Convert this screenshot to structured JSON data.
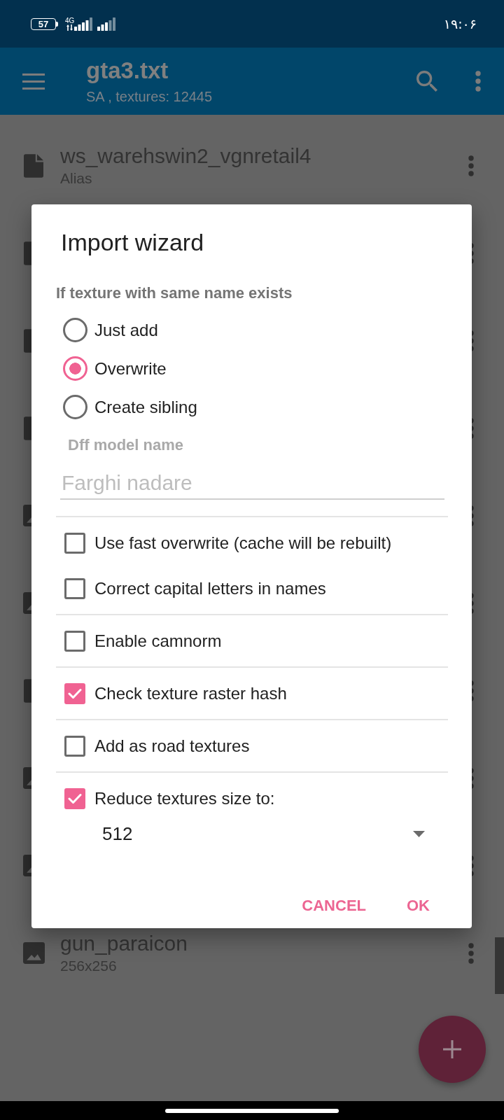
{
  "status_bar": {
    "battery": "57",
    "network": "4G",
    "time": "۱۹:۰۶"
  },
  "toolbar": {
    "title": "gta3.txt",
    "subtitle": "SA , textures: 12445"
  },
  "files": [
    {
      "kind": "file",
      "name": "ws_warehswin2_vgnretail4",
      "detail": "Alias"
    },
    {
      "kind": "file"
    },
    {
      "kind": "file"
    },
    {
      "kind": "file"
    },
    {
      "kind": "image"
    },
    {
      "kind": "image"
    },
    {
      "kind": "file"
    },
    {
      "kind": "image"
    },
    {
      "kind": "image"
    },
    {
      "kind": "image",
      "name": "gun_paraicon",
      "detail": "256x256"
    }
  ],
  "dialog": {
    "title": "Import wizard",
    "section_label": "If texture with same name exists",
    "options": [
      {
        "label": "Just add",
        "selected": false
      },
      {
        "label": "Overwrite",
        "selected": true
      },
      {
        "label": "Create sibling",
        "selected": false
      }
    ],
    "model_field": {
      "label": "Dff model name",
      "placeholder": "Farghi nadare",
      "disabled": true
    },
    "checkbox_groups": [
      {
        "items": [
          {
            "label": "Use fast overwrite (cache will be rebuilt)",
            "checked": false
          },
          {
            "label": "Correct capital letters in names",
            "checked": false
          }
        ]
      },
      {
        "items": [
          {
            "label": "Enable camnorm",
            "checked": false
          }
        ]
      },
      {
        "items": [
          {
            "label": "Check texture raster hash",
            "checked": true
          }
        ]
      },
      {
        "items": [
          {
            "label": "Add as road textures",
            "checked": false
          }
        ]
      },
      {
        "items": [
          {
            "label": "Reduce textures size to:",
            "checked": true
          }
        ]
      }
    ],
    "size_select": {
      "value": "512"
    },
    "buttons": [
      {
        "label": "CANCEL"
      },
      {
        "label": "OK"
      }
    ]
  }
}
